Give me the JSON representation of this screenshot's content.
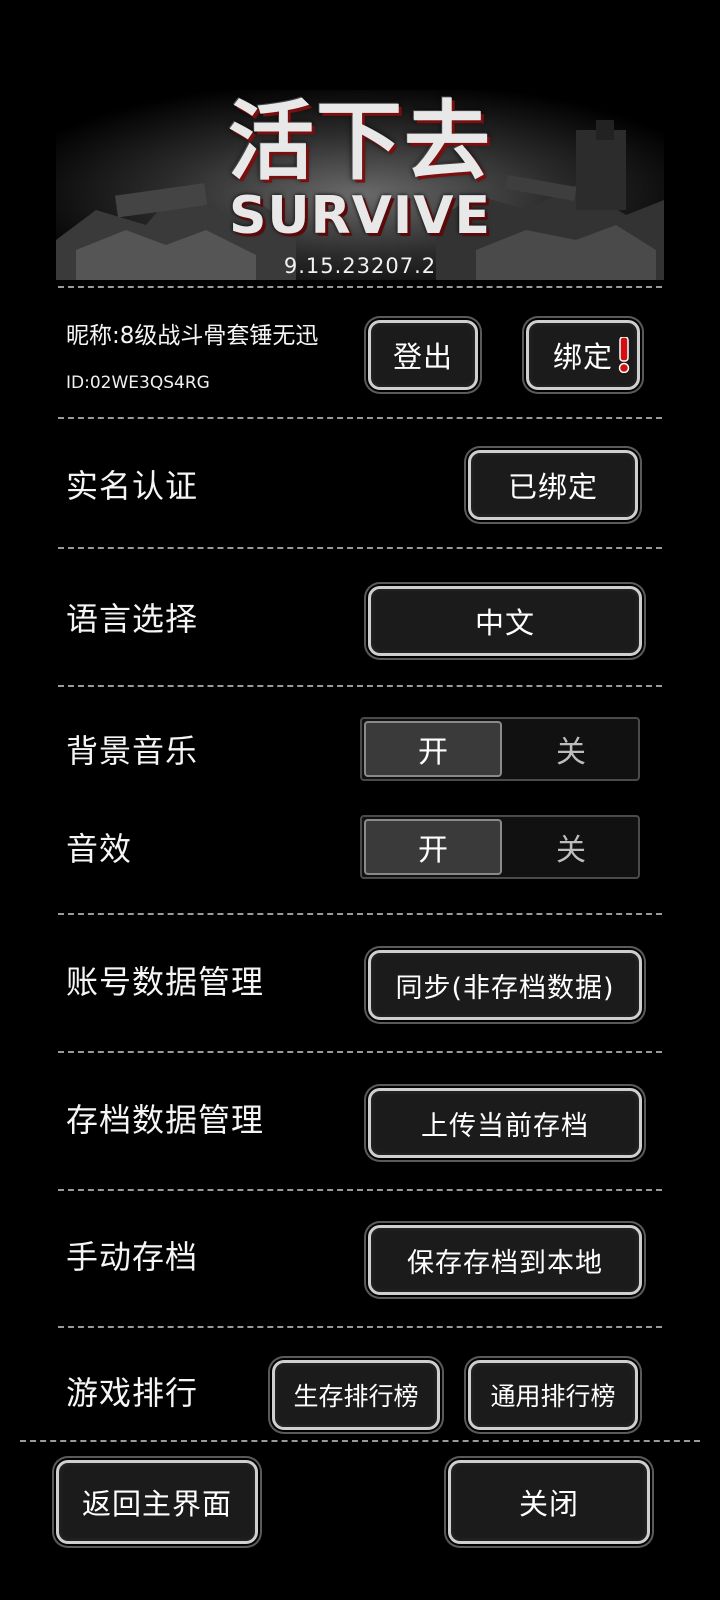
{
  "header": {
    "title_cn": "活下去",
    "title_en": "SURVIVE",
    "version": "9.15.23207.2"
  },
  "account": {
    "nickname": "昵称:8级战斗骨套锤无迅",
    "id": "ID:02WE3QS4RG",
    "logout_label": "登出",
    "bind_label": "绑定",
    "bind_alert_icon": "exclamation-icon",
    "alert_color": "#d01010"
  },
  "settings": {
    "realname": {
      "label": "实名认证",
      "button": "已绑定"
    },
    "language": {
      "label": "语言选择",
      "button": "中文"
    },
    "bgm": {
      "label": "背景音乐",
      "on": "开",
      "off": "关",
      "selected": "开"
    },
    "sfx": {
      "label": "音效",
      "on": "开",
      "off": "关",
      "selected": "开"
    },
    "account_data": {
      "label": "账号数据管理",
      "button": "同步(非存档数据)"
    },
    "save_data": {
      "label": "存档数据管理",
      "button": "上传当前存档"
    },
    "manual_save": {
      "label": "手动存档",
      "button": "保存存档到本地"
    },
    "ranking": {
      "label": "游戏排行",
      "survival_button": "生存排行榜",
      "general_button": "通用排行榜"
    }
  },
  "footer": {
    "back_label": "返回主界面",
    "close_label": "关闭"
  }
}
